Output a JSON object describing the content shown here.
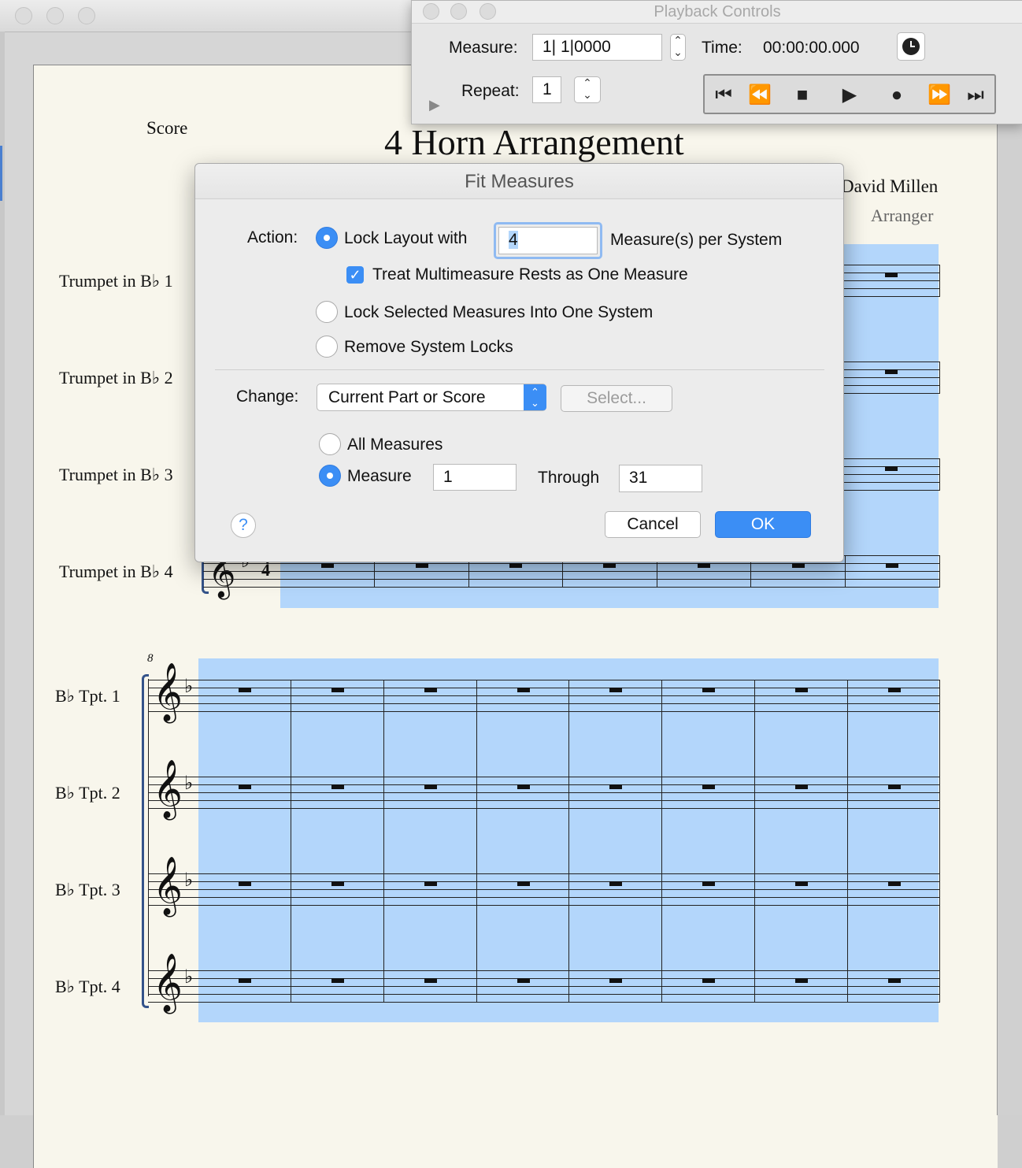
{
  "playback": {
    "title": "Playback Controls",
    "measure_label": "Measure:",
    "measure_value": "1| 1|0000",
    "time_label": "Time:",
    "time_value": "00:00:00.000",
    "repeat_label": "Repeat:",
    "repeat_value": "1"
  },
  "score": {
    "label": "Score",
    "title": "4 Horn Arrangement",
    "composer": "David Millen",
    "arranger": "Arranger",
    "system1_instruments": [
      "Trumpet in B♭ 1",
      "Trumpet in B♭ 2",
      "Trumpet in B♭ 3",
      "Trumpet in B♭ 4"
    ],
    "system2_measure_number": "8",
    "system2_instruments": [
      "B♭ Tpt. 1",
      "B♭ Tpt. 2",
      "B♭ Tpt. 3",
      "B♭ Tpt. 4"
    ],
    "time_signature_top": "4",
    "time_signature_bottom": "4"
  },
  "dialog": {
    "title": "Fit Measures",
    "action_label": "Action:",
    "lock_layout_label": "Lock Layout with",
    "measures_per_system_value": "4",
    "measures_per_system_label": "Measure(s) per System",
    "treat_rests_label": "Treat Multimeasure Rests as One Measure",
    "lock_selected_label": "Lock Selected Measures Into One System",
    "remove_locks_label": "Remove System Locks",
    "change_label": "Change:",
    "change_select_value": "Current Part or Score",
    "select_button": "Select...",
    "all_measures_label": "All Measures",
    "measure_label": "Measure",
    "measure_from": "1",
    "through_label": "Through",
    "measure_to": "31",
    "help": "?",
    "cancel": "Cancel",
    "ok": "OK"
  },
  "colors": {
    "selection": "#b3d6fb",
    "accent": "#3b8ef5",
    "paper": "#f8f6ec"
  }
}
